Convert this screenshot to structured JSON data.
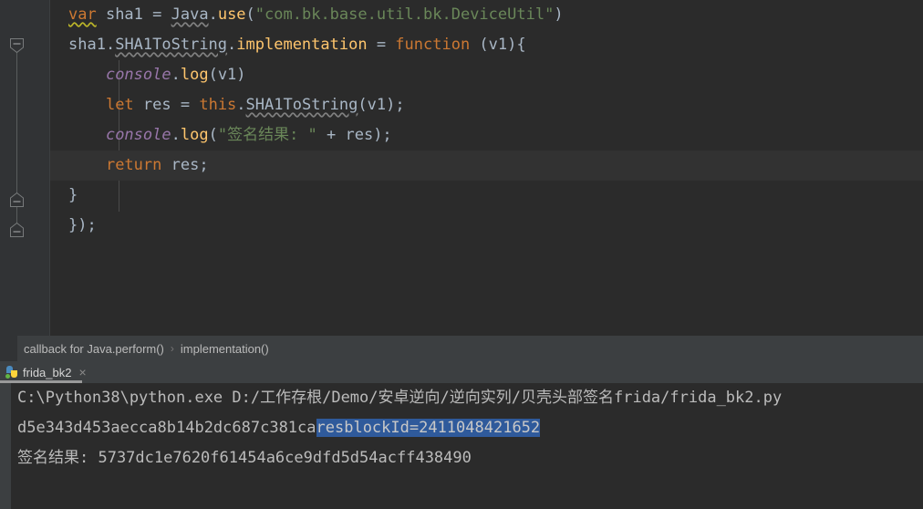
{
  "editor": {
    "lines": [
      {
        "id": "line-1",
        "tokens": [
          {
            "t": "var",
            "c": "kw sq-warn"
          },
          {
            "t": " sha1 ",
            "c": "plain"
          },
          {
            "t": "= ",
            "c": "punc"
          },
          {
            "t": "Java",
            "c": "cls sq-gray"
          },
          {
            "t": ".",
            "c": "punc"
          },
          {
            "t": "use",
            "c": "method"
          },
          {
            "t": "(",
            "c": "punc"
          },
          {
            "t": "\"com.bk.base.util.bk.DeviceUtil\"",
            "c": "str"
          },
          {
            "t": ")",
            "c": "punc"
          }
        ]
      },
      {
        "id": "line-2",
        "tokens": [
          {
            "t": "sha1",
            "c": "plain"
          },
          {
            "t": ".",
            "c": "punc"
          },
          {
            "t": "SHA1ToString",
            "c": "cls sq-gray"
          },
          {
            "t": ".",
            "c": "punc"
          },
          {
            "t": "implementation",
            "c": "method"
          },
          {
            "t": " = ",
            "c": "punc"
          },
          {
            "t": "function",
            "c": "kw"
          },
          {
            "t": " (v1){",
            "c": "punc"
          }
        ]
      },
      {
        "id": "line-3",
        "tokens": [
          {
            "t": "    ",
            "c": "plain"
          },
          {
            "t": "console",
            "c": "field"
          },
          {
            "t": ".",
            "c": "punc"
          },
          {
            "t": "log",
            "c": "method"
          },
          {
            "t": "(v1)",
            "c": "punc"
          }
        ]
      },
      {
        "id": "line-4",
        "tokens": [
          {
            "t": "    ",
            "c": "plain"
          },
          {
            "t": "let",
            "c": "kw"
          },
          {
            "t": " res ",
            "c": "plain"
          },
          {
            "t": "= ",
            "c": "punc"
          },
          {
            "t": "this",
            "c": "kw"
          },
          {
            "t": ".",
            "c": "punc"
          },
          {
            "t": "SHA1ToString",
            "c": "plain sq-gray"
          },
          {
            "t": "(v1);",
            "c": "punc"
          }
        ]
      },
      {
        "id": "line-5",
        "tokens": [
          {
            "t": "    ",
            "c": "plain"
          },
          {
            "t": "console",
            "c": "field"
          },
          {
            "t": ".",
            "c": "punc"
          },
          {
            "t": "log",
            "c": "method"
          },
          {
            "t": "(",
            "c": "punc"
          },
          {
            "t": "\"签名结果: \"",
            "c": "str"
          },
          {
            "t": " + res);",
            "c": "punc"
          }
        ]
      },
      {
        "id": "line-6",
        "current": true,
        "tokens": [
          {
            "t": "    ",
            "c": "plain"
          },
          {
            "t": "return",
            "c": "kw"
          },
          {
            "t": " res;",
            "c": "punc"
          }
        ]
      },
      {
        "id": "line-7",
        "tokens": [
          {
            "t": "}",
            "c": "punc"
          }
        ]
      },
      {
        "id": "line-8",
        "tokens": [
          {
            "t": "});",
            "c": "punc"
          }
        ]
      }
    ]
  },
  "breadcrumb": {
    "items": [
      "callback for Java.perform()",
      "implementation()"
    ],
    "separator": "›"
  },
  "tab": {
    "label": "frida_bk2",
    "close": "×",
    "icon": "python-file-icon"
  },
  "console": {
    "lines": [
      {
        "id": "console-line-1",
        "segments": [
          {
            "t": "C:\\Python38\\python.exe D:/工作存根/Demo/安卓逆向/逆向实列/贝壳头部签名frida/frida_bk2.py",
            "sel": false
          }
        ]
      },
      {
        "id": "console-line-2",
        "segments": [
          {
            "t": "d5e343d453aecca8b14b2dc687c381ca",
            "sel": false
          },
          {
            "t": "resblockId=2411048421652",
            "sel": true
          }
        ]
      },
      {
        "id": "console-line-3",
        "segments": [
          {
            "t": "签名结果: 5737dc1e7620f61454a6ce9dfd5d54acff438490",
            "sel": false
          }
        ]
      }
    ]
  },
  "colors": {
    "editor_bg": "#2b2b2b",
    "gutter_bg": "#313335",
    "current_line_bg": "#323232",
    "panel_bg": "#3c3f41",
    "keyword": "#cc7832",
    "method": "#ffc66d",
    "string": "#6a8759",
    "field": "#9876aa",
    "text": "#a9b7c6",
    "selection": "#2f5a9b",
    "console_text": "#bbbbbb"
  }
}
